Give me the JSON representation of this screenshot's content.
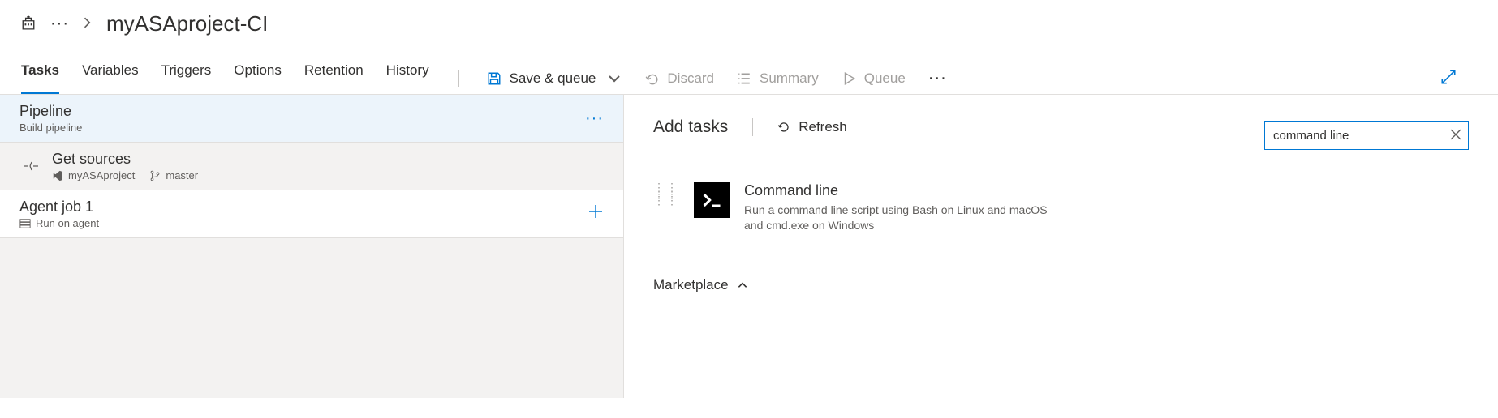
{
  "breadcrumb": {
    "title": "myASAproject-CI"
  },
  "tabs": {
    "tasks": "Tasks",
    "variables": "Variables",
    "triggers": "Triggers",
    "options": "Options",
    "retention": "Retention",
    "history": "History"
  },
  "toolbar": {
    "save_queue": "Save & queue",
    "discard": "Discard",
    "summary": "Summary",
    "queue": "Queue"
  },
  "left": {
    "pipeline": {
      "title": "Pipeline",
      "subtitle": "Build pipeline"
    },
    "sources": {
      "title": "Get sources",
      "repo": "myASAproject",
      "branch": "master"
    },
    "agent": {
      "title": "Agent job 1",
      "subtitle": "Run on agent"
    }
  },
  "right": {
    "title": "Add tasks",
    "refresh": "Refresh",
    "search_value": "command line",
    "task": {
      "title": "Command line",
      "desc": "Run a command line script using Bash on Linux and macOS and cmd.exe on Windows"
    },
    "marketplace": "Marketplace"
  }
}
